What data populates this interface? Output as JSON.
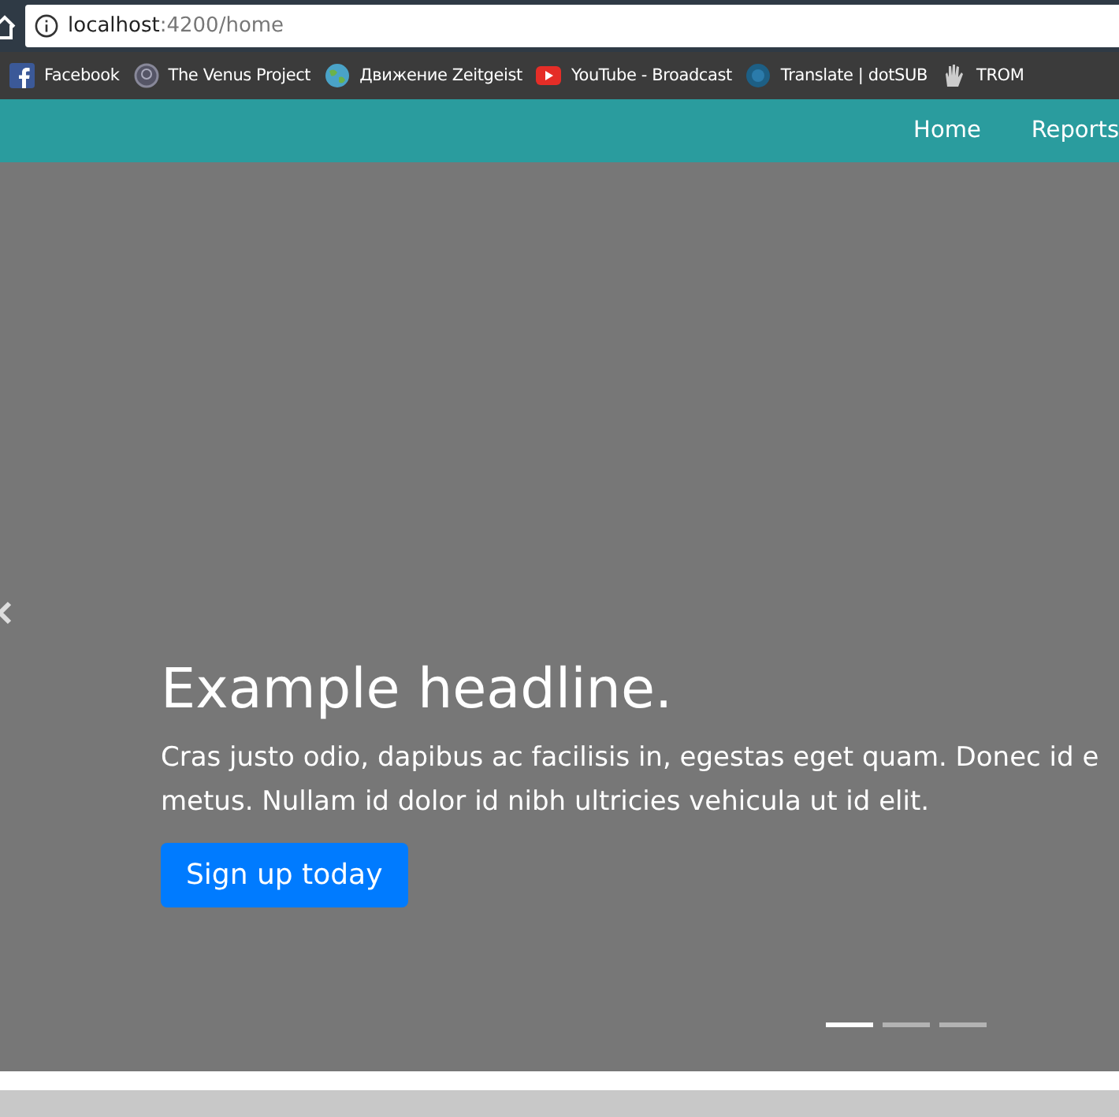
{
  "browser": {
    "address_host": "localhost",
    "address_rest": ":4200/home"
  },
  "bookmarks": [
    {
      "label": "Facebook",
      "kind": "facebook"
    },
    {
      "label": "The Venus Project",
      "kind": "venus"
    },
    {
      "label": "Движение Zeitgeist",
      "kind": "globe"
    },
    {
      "label": "YouTube - Broadcast",
      "kind": "youtube"
    },
    {
      "label": "Translate | dotSUB",
      "kind": "dotsub"
    },
    {
      "label": "TROM",
      "kind": "hand"
    }
  ],
  "navbar": {
    "links": [
      "Home",
      "Reports"
    ]
  },
  "carousel": {
    "headline": "Example headline.",
    "lines": [
      "Cras justo odio, dapibus ac facilisis in, egestas eget quam. Donec id e",
      "metus. Nullam id dolor id nibh ultricies vehicula ut id elit."
    ],
    "button": "Sign up today",
    "indicators": [
      {
        "selected": true
      },
      {
        "selected": false
      },
      {
        "selected": false
      }
    ]
  }
}
